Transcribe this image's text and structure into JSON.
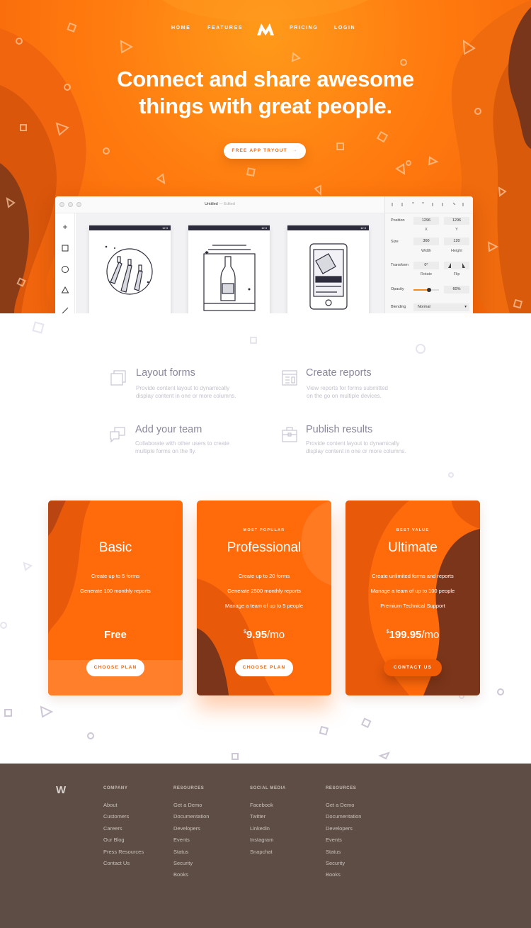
{
  "nav": {
    "left": [
      "HOME",
      "FEATURES"
    ],
    "right": [
      "PRICING",
      "LOGIN"
    ],
    "logo_icon": "m-logo-icon"
  },
  "hero": {
    "headline_line1": "Connect and share awesome",
    "headline_line2": "things with great people.",
    "cta": "FREE APP TRYOUT",
    "cta_arrow": "→"
  },
  "app_window": {
    "doc_title": "Untitled",
    "doc_status": "— Edited",
    "status_time": "12:3",
    "inspector": {
      "position_label": "Position",
      "position_x": "1296",
      "position_y": "1296",
      "x_label": "X",
      "y_label": "Y",
      "size_label": "Size",
      "width": "360",
      "height": "120",
      "width_label": "Width",
      "height_label": "Height",
      "transform_label": "Transform",
      "rotate_value": "0°",
      "rotate_label": "Rotate",
      "flip_label": "Flip",
      "opacity_label": "Opacity",
      "opacity_value": "60%",
      "opacity_level": 0.6,
      "blending_label": "Blending",
      "blending_value": "Normal"
    }
  },
  "features": [
    {
      "title": "Layout forms",
      "desc_line1": "Provide content layout to dynamically",
      "desc_line2": "display content in one or more columns.",
      "icon": "layout-icon"
    },
    {
      "title": "Create reports",
      "desc_line1": "View reports for forms submitted",
      "desc_line2": "on the go on multiple devices.",
      "icon": "report-icon"
    },
    {
      "title": "Add your team",
      "desc_line1": "Collaborate with other users to create",
      "desc_line2": "multiple forms on the fly.",
      "icon": "chat-icon"
    },
    {
      "title": "Publish results",
      "desc_line1": "Provide content layout to dynamically",
      "desc_line2": "display content in one or more columns.",
      "icon": "briefcase-icon"
    }
  ],
  "plans": [
    {
      "badge": "",
      "name": "Basic",
      "features": [
        "Create up to 5 forms",
        "Generate 100 monthly reports"
      ],
      "price_text": "Free",
      "button": "CHOOSE PLAN"
    },
    {
      "badge": "MOST POPULAR",
      "name": "Professional",
      "features": [
        "Create up to 20 forms",
        "Generate 2500 monthly reports",
        "Manage a team of up to 5 people"
      ],
      "currency": "$",
      "price": "9.95",
      "period": "/mo",
      "button": "CHOOSE PLAN"
    },
    {
      "badge": "BEST VALUE",
      "name": "Ultimate",
      "features": [
        "Create unlimited forms and reports",
        "Manage a team of up to 100 people",
        "Premium Technical Support"
      ],
      "currency": "$",
      "price": "199.95",
      "period": "/mo",
      "button": "CONTACT US"
    }
  ],
  "footer": {
    "logo": "W",
    "columns": [
      {
        "heading": "COMPANY",
        "links": [
          "About",
          "Customers",
          "Careers",
          "Our Blog",
          "Press Resources",
          "Contact Us"
        ]
      },
      {
        "heading": "RESOURCES",
        "links": [
          "Get a Demo",
          "Documentation",
          "Developers",
          "Events",
          "Status",
          "Security",
          "Books"
        ]
      },
      {
        "heading": "SOCIAL MEDIA",
        "links": [
          "Facebook",
          "Twitter",
          "Linkedin",
          "Instagram",
          "Snapchat"
        ]
      },
      {
        "heading": "RESOURCES",
        "links": [
          "Get a Demo",
          "Documentation",
          "Developers",
          "Events",
          "Status",
          "Security",
          "Books"
        ]
      }
    ]
  },
  "colors": {
    "brand_orange": "#ff7a0f",
    "dark_orange": "#e2560a",
    "brown": "#7a3a1e",
    "footer_bg": "#5d4d44"
  }
}
